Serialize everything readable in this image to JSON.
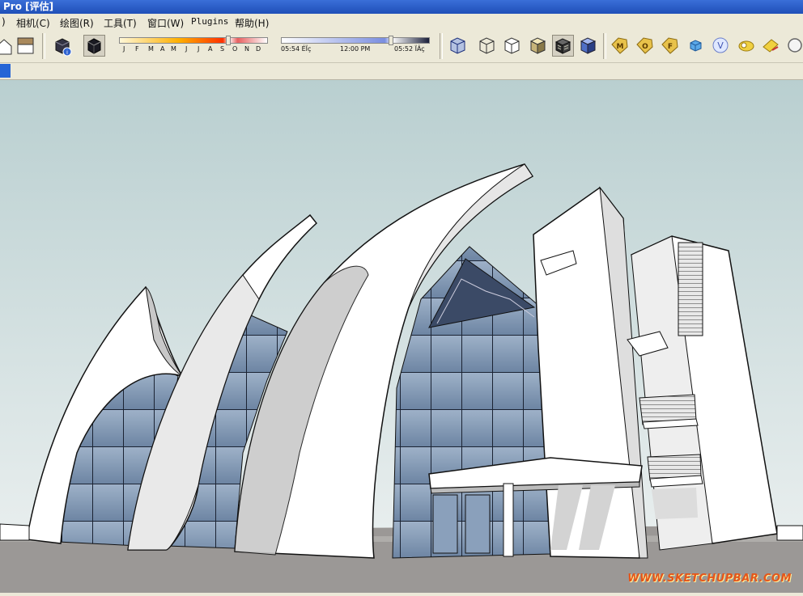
{
  "window": {
    "title": "Pro [评估]"
  },
  "menu": {
    "items": [
      {
        "label": ")"
      },
      {
        "label": "相机(C)"
      },
      {
        "label": "绘图(R)"
      },
      {
        "label": "工具(T)"
      },
      {
        "label": "窗口(W)"
      },
      {
        "label": "Plugins"
      },
      {
        "label": "帮助(H)"
      }
    ]
  },
  "shadow_settings": {
    "months": [
      "J",
      "F",
      "M",
      "A",
      "M",
      "J",
      "J",
      "A",
      "S",
      "O",
      "N",
      "D"
    ],
    "time_start": "05:54 ÉÏç",
    "time_mid": "12:00 PM",
    "time_end": "05:52 ÏÂç"
  },
  "toolbar": {
    "icons": [
      "home-icon",
      "section-icon",
      "shadow-info-icon",
      "shadow-toggle-icon",
      "xray-icon",
      "wireframe-icon",
      "hidden-line-icon",
      "shaded-icon",
      "shaded-texture-icon",
      "monochrome-icon",
      "material-tag-icon",
      "component-tag-icon",
      "follow-tag-icon",
      "solid-icon",
      "v-icon",
      "tape-icon",
      "dimension-icon",
      "circle-icon"
    ]
  },
  "colors": {
    "accent": "#2565d6",
    "title_bar": "#1f4fb8",
    "sky_top": "#b9cfd0",
    "sky_bottom": "#e8eeee",
    "ground": "#9b9896",
    "watermark": "#e5561a"
  },
  "watermark": "WWW.SKETCHUPBAR.COM"
}
